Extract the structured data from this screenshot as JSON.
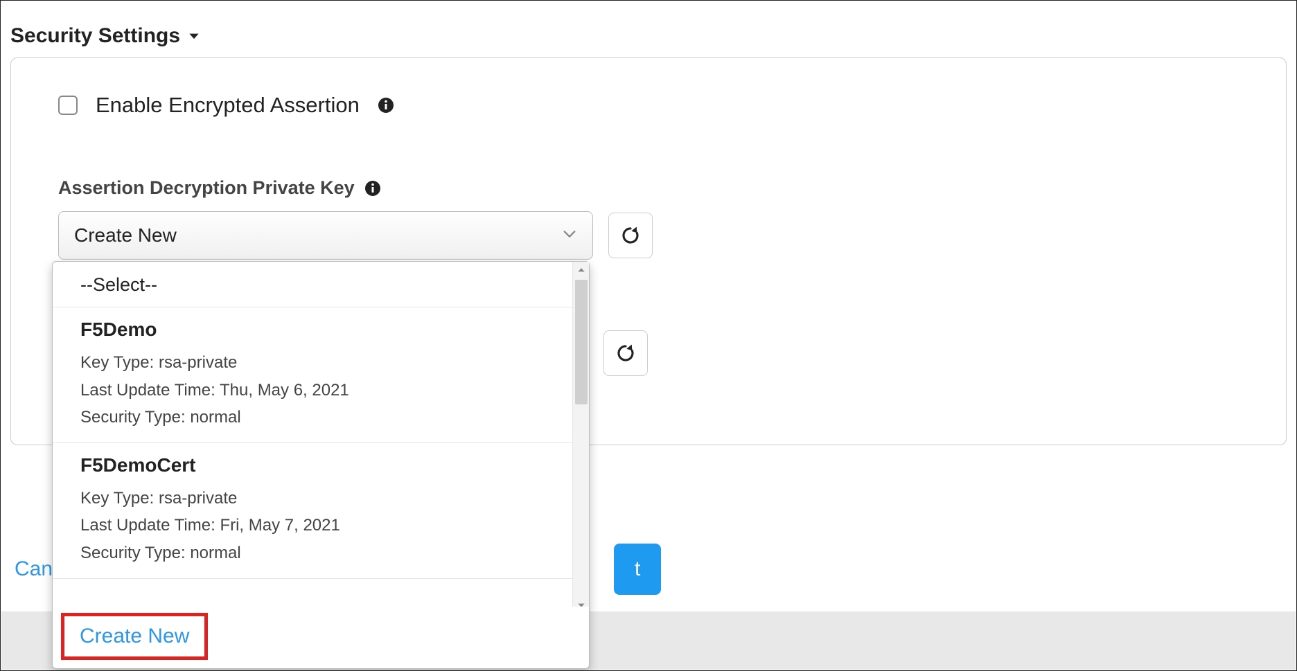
{
  "section": {
    "title": "Security Settings"
  },
  "checkbox": {
    "label": "Enable Encrypted Assertion"
  },
  "field": {
    "label": "Assertion Decryption Private Key",
    "selected": "Create New"
  },
  "dropdown": {
    "select_placeholder": "--Select--",
    "options": [
      {
        "name": "F5Demo",
        "key_type_label": "Key Type:",
        "key_type_value": "rsa-private",
        "last_update_label": "Last Update Time:",
        "last_update_value": "Thu, May 6, 2021",
        "security_type_label": "Security Type:",
        "security_type_value": "normal"
      },
      {
        "name": "F5DemoCert",
        "key_type_label": "Key Type:",
        "key_type_value": "rsa-private",
        "last_update_label": "Last Update Time:",
        "last_update_value": "Fri, May 7, 2021",
        "security_type_label": "Security Type:",
        "security_type_value": "normal"
      }
    ],
    "create_new": "Create New"
  },
  "buttons": {
    "cancel_partial": "Can",
    "next_partial": "t"
  }
}
